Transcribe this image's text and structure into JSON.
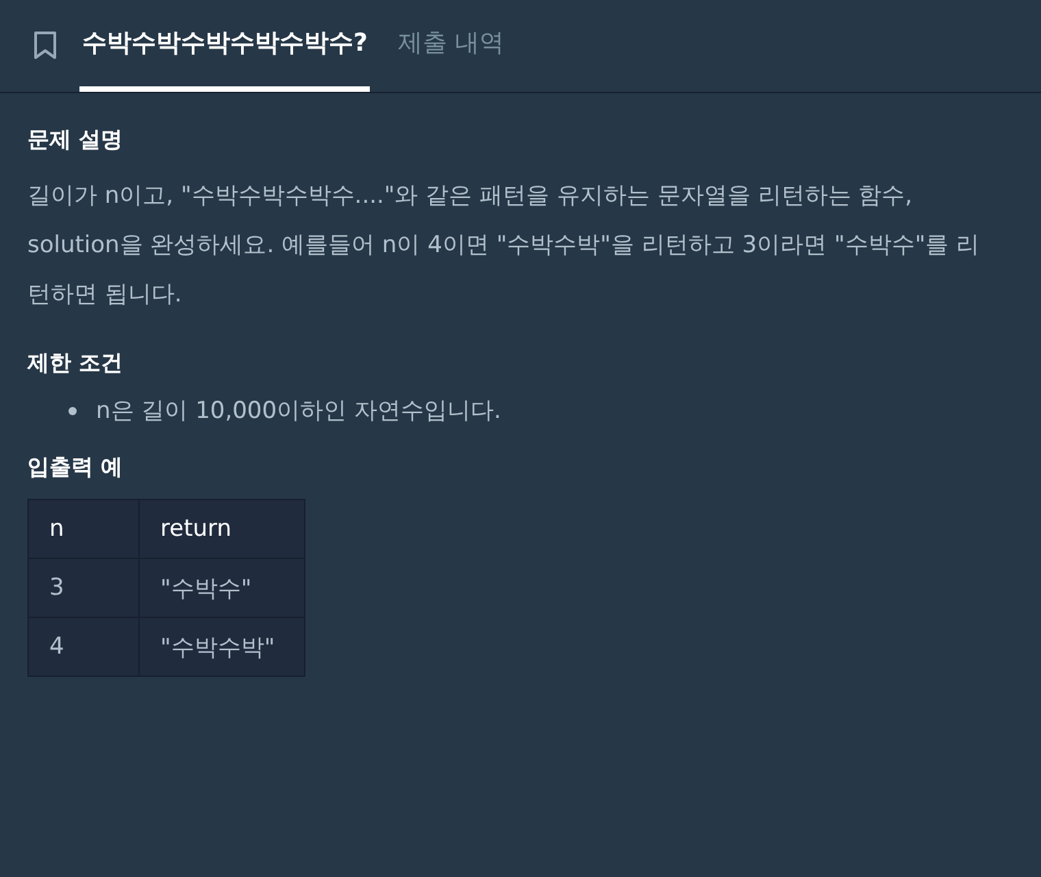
{
  "tabs": [
    {
      "label": "수박수박수박수박수박수?",
      "selected": true
    },
    {
      "label": "제출 내역",
      "selected": false
    }
  ],
  "sections": [
    {
      "kind": "paragraph",
      "heading": "문제 설명",
      "text": "길이가 n이고, \"수박수박수박수....\"와 같은 패턴을 유지하는 문자열을 리턴하는 함수, solution을 완성하세요. 예를들어 n이 4이면 \"수박수박\"을 리턴하고 3이라면 \"수박수\"를 리턴하면 됩니다."
    },
    {
      "kind": "list",
      "heading": "제한 조건",
      "items": [
        "n은 길이 10,000이하인 자연수입니다."
      ]
    },
    {
      "kind": "table",
      "heading": "입출력 예",
      "columns": [
        "n",
        "return"
      ],
      "rows": [
        [
          "3",
          "\"수박수\""
        ],
        [
          "4",
          "\"수박수박\""
        ]
      ]
    }
  ]
}
